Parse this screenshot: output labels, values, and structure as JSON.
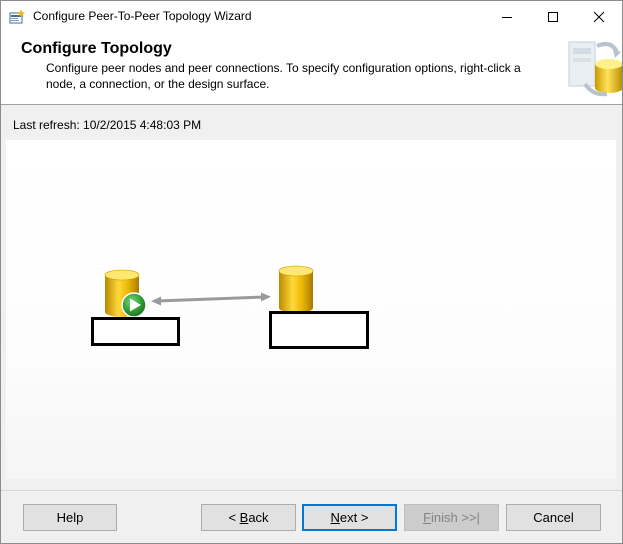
{
  "window": {
    "title": "Configure Peer-To-Peer Topology Wizard"
  },
  "header": {
    "title": "Configure Topology",
    "description": "Configure peer nodes and peer connections. To specify configuration options, right-click a node, a connection, or the design surface."
  },
  "status": {
    "last_refresh": "Last refresh: 10/2/2015 4:48:03 PM"
  },
  "topology": {
    "nodes": [
      {
        "label": "",
        "is_publisher": true
      },
      {
        "label": "",
        "is_publisher": false
      }
    ],
    "connection": {
      "direction": "bidirectional"
    }
  },
  "buttons": {
    "help": "Help",
    "back_prefix": "< ",
    "back_accel": "B",
    "back_rest": "ack",
    "next_accel": "N",
    "next_rest": "ext >",
    "finish_accel": "F",
    "finish_rest": "inish >>|",
    "cancel": "Cancel"
  },
  "colors": {
    "accent": "#0078d7",
    "node_gold": "#e6b400",
    "play_green": "#2e9b2e"
  }
}
